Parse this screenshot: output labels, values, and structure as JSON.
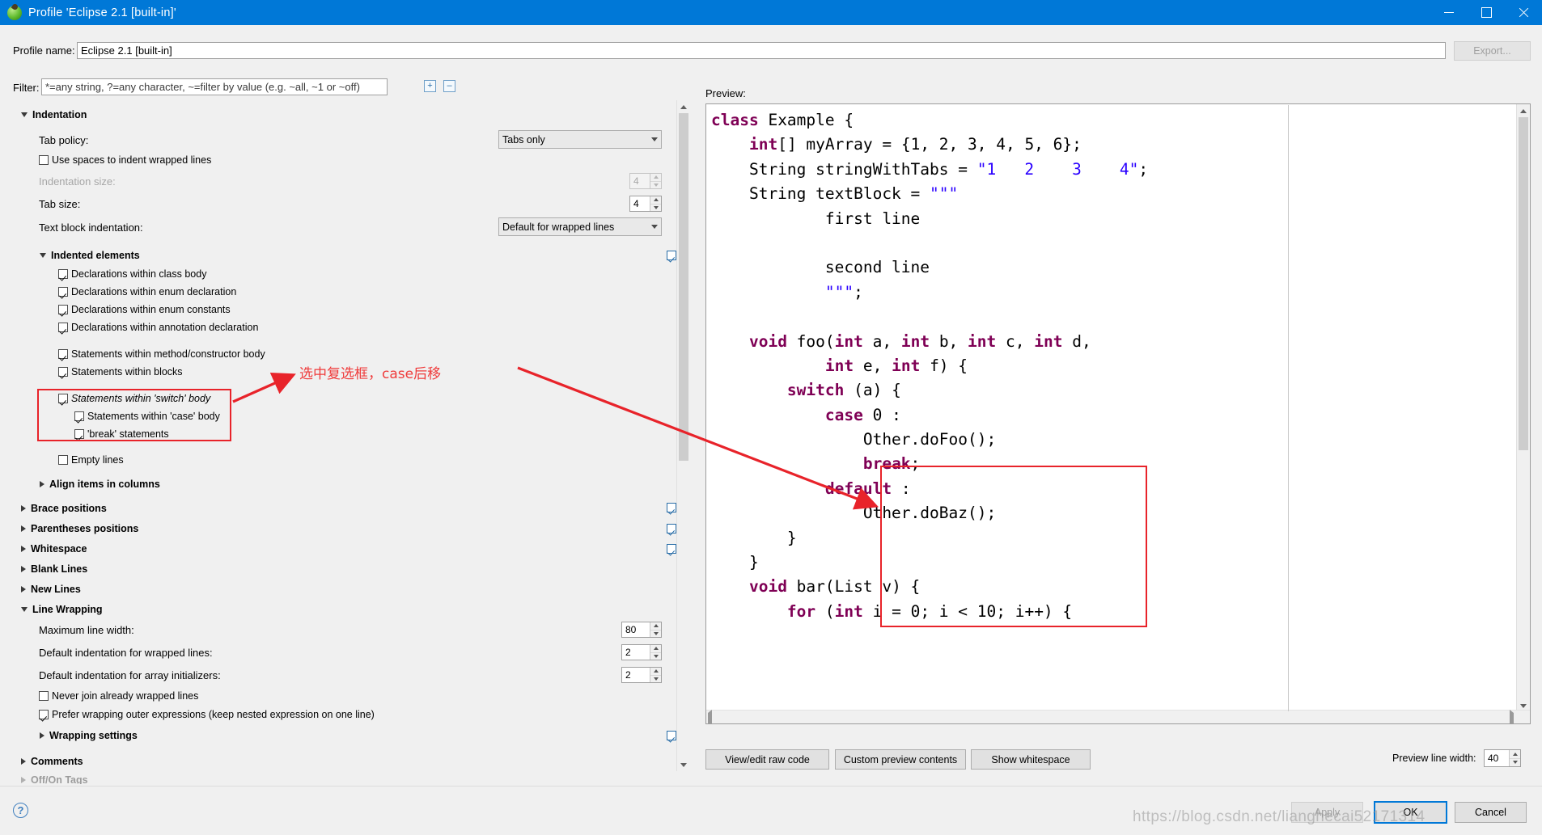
{
  "window": {
    "title": "Profile 'Eclipse 2.1 [built-in]'",
    "icon": "eclipse-profile-icon",
    "minimize": "─",
    "maximize": "□",
    "close": "✕"
  },
  "profile": {
    "name_label": "Profile name:",
    "name_value": "Eclipse 2.1 [built-in]",
    "export_button": "Export..."
  },
  "filter": {
    "label": "Filter:",
    "placeholder": "*=any string, ?=any character, ~=filter by value (e.g. ~all, ~1 or ~off)",
    "expand_all_icon": "expand-all-icon",
    "collapse_all_icon": "collapse-all-icon"
  },
  "tree": {
    "indentation": {
      "label": "Indentation",
      "expanded": true,
      "tab_policy_label": "Tab policy:",
      "tab_policy_value": "Tabs only",
      "use_spaces_label": "Use spaces to indent wrapped lines",
      "use_spaces_checked": false,
      "indentation_size_label": "Indentation size:",
      "indentation_size_value": "4",
      "indentation_size_enabled": false,
      "tab_size_label": "Tab size:",
      "tab_size_value": "4",
      "text_block_label": "Text block indentation:",
      "text_block_value": "Default for wrapped lines",
      "indented_elements_label": "Indented elements",
      "items": [
        {
          "label": "Declarations within class body",
          "checked": true,
          "indent": 0,
          "italic": false
        },
        {
          "label": "Declarations within enum declaration",
          "checked": true,
          "indent": 0,
          "italic": false
        },
        {
          "label": "Declarations within enum constants",
          "checked": true,
          "indent": 0,
          "italic": false
        },
        {
          "label": "Declarations within annotation declaration",
          "checked": true,
          "indent": 0,
          "italic": false
        },
        {
          "label": "Statements within method/constructor body",
          "checked": true,
          "indent": 0,
          "italic": false
        },
        {
          "label": "Statements within blocks",
          "checked": true,
          "indent": 0,
          "italic": false
        },
        {
          "label": "Statements within 'switch' body",
          "checked": true,
          "indent": 0,
          "italic": true
        },
        {
          "label": "Statements within 'case' body",
          "checked": true,
          "indent": 1,
          "italic": false
        },
        {
          "label": "'break' statements",
          "checked": true,
          "indent": 1,
          "italic": false
        },
        {
          "label": "Empty lines",
          "checked": false,
          "indent": 0,
          "italic": false
        }
      ],
      "align_items_label": "Align items in columns"
    },
    "sections": [
      {
        "label": "Brace positions",
        "expanded": false
      },
      {
        "label": "Parentheses positions",
        "expanded": false
      },
      {
        "label": "Whitespace",
        "expanded": false
      },
      {
        "label": "Blank Lines",
        "expanded": false
      },
      {
        "label": "New Lines",
        "expanded": false
      }
    ],
    "line_wrapping": {
      "label": "Line Wrapping",
      "expanded": true,
      "max_line_width_label": "Maximum line width:",
      "max_line_width_value": "80",
      "default_indent_wrapped_label": "Default indentation for wrapped lines:",
      "default_indent_wrapped_value": "2",
      "default_indent_array_label": "Default indentation for array initializers:",
      "default_indent_array_value": "2",
      "never_join_label": "Never join already wrapped lines",
      "never_join_checked": false,
      "prefer_wrapping_label": "Prefer wrapping outer expressions (keep nested expression on one line)",
      "prefer_wrapping_checked": true,
      "wrapping_settings_label": "Wrapping settings"
    },
    "comments": {
      "label": "Comments",
      "expanded": false
    },
    "off_on": {
      "label": "Off/On Tags",
      "expanded": false
    }
  },
  "preview": {
    "label": "Preview:",
    "lines": [
      [
        {
          "t": "class ",
          "c": "kw"
        },
        {
          "t": "Example {",
          "c": ""
        }
      ],
      [
        {
          "t": "    ",
          "c": ""
        },
        {
          "t": "int",
          "c": "kw"
        },
        {
          "t": "[] myArray = {1, 2, 3, 4, 5, 6};",
          "c": ""
        }
      ],
      [
        {
          "t": "    String stringWithTabs = ",
          "c": ""
        },
        {
          "t": "\"1   2    3    4\"",
          "c": "str"
        },
        {
          "t": ";",
          "c": ""
        }
      ],
      [
        {
          "t": "    String textBlock = ",
          "c": ""
        },
        {
          "t": "\"\"\"",
          "c": "str"
        }
      ],
      [
        {
          "t": "            first line",
          "c": ""
        }
      ],
      [
        {
          "t": "",
          "c": ""
        }
      ],
      [
        {
          "t": "            second line",
          "c": ""
        }
      ],
      [
        {
          "t": "            ",
          "c": ""
        },
        {
          "t": "\"\"\"",
          "c": "str"
        },
        {
          "t": ";",
          "c": ""
        }
      ],
      [
        {
          "t": "",
          "c": ""
        }
      ],
      [
        {
          "t": "    ",
          "c": ""
        },
        {
          "t": "void ",
          "c": "kw"
        },
        {
          "t": "foo(",
          "c": ""
        },
        {
          "t": "int",
          "c": "kw"
        },
        {
          "t": " a, ",
          "c": ""
        },
        {
          "t": "int",
          "c": "kw"
        },
        {
          "t": " b, ",
          "c": ""
        },
        {
          "t": "int",
          "c": "kw"
        },
        {
          "t": " c, ",
          "c": ""
        },
        {
          "t": "int",
          "c": "kw"
        },
        {
          "t": " d,",
          "c": ""
        }
      ],
      [
        {
          "t": "            ",
          "c": ""
        },
        {
          "t": "int",
          "c": "kw"
        },
        {
          "t": " e, ",
          "c": ""
        },
        {
          "t": "int",
          "c": "kw"
        },
        {
          "t": " f) {",
          "c": ""
        }
      ],
      [
        {
          "t": "        ",
          "c": ""
        },
        {
          "t": "switch ",
          "c": "kw"
        },
        {
          "t": "(a) {",
          "c": ""
        }
      ],
      [
        {
          "t": "            ",
          "c": ""
        },
        {
          "t": "case ",
          "c": "kw"
        },
        {
          "t": "0 :",
          "c": ""
        }
      ],
      [
        {
          "t": "                Other.doFoo();",
          "c": ""
        }
      ],
      [
        {
          "t": "                ",
          "c": ""
        },
        {
          "t": "break",
          "c": "kw"
        },
        {
          "t": ";",
          "c": ""
        }
      ],
      [
        {
          "t": "            ",
          "c": ""
        },
        {
          "t": "default ",
          "c": "kw"
        },
        {
          "t": ":",
          "c": ""
        }
      ],
      [
        {
          "t": "                Other.doBaz();",
          "c": ""
        }
      ],
      [
        {
          "t": "        }",
          "c": ""
        }
      ],
      [
        {
          "t": "    }",
          "c": ""
        }
      ],
      [
        {
          "t": "    ",
          "c": ""
        },
        {
          "t": "void ",
          "c": "kw"
        },
        {
          "t": "bar(List v) {",
          "c": ""
        }
      ],
      [
        {
          "t": "        ",
          "c": ""
        },
        {
          "t": "for ",
          "c": "kw"
        },
        {
          "t": "(",
          "c": ""
        },
        {
          "t": "int",
          "c": "kw"
        },
        {
          "t": " i = 0; i < 10; i++) {",
          "c": ""
        }
      ]
    ],
    "buttons": {
      "raw_code": "View/edit raw code",
      "custom_contents": "Custom preview contents",
      "show_whitespace": "Show whitespace"
    },
    "line_width_label": "Preview line width:",
    "line_width_value": "40"
  },
  "footer": {
    "help_icon": "help-icon",
    "apply": "Apply",
    "ok": "OK",
    "cancel": "Cancel"
  },
  "annotations": {
    "note": "选中复选框，case后移",
    "color": "#ef3b3b"
  },
  "watermark": "https://blog.csdn.net/lianghecai52171314"
}
